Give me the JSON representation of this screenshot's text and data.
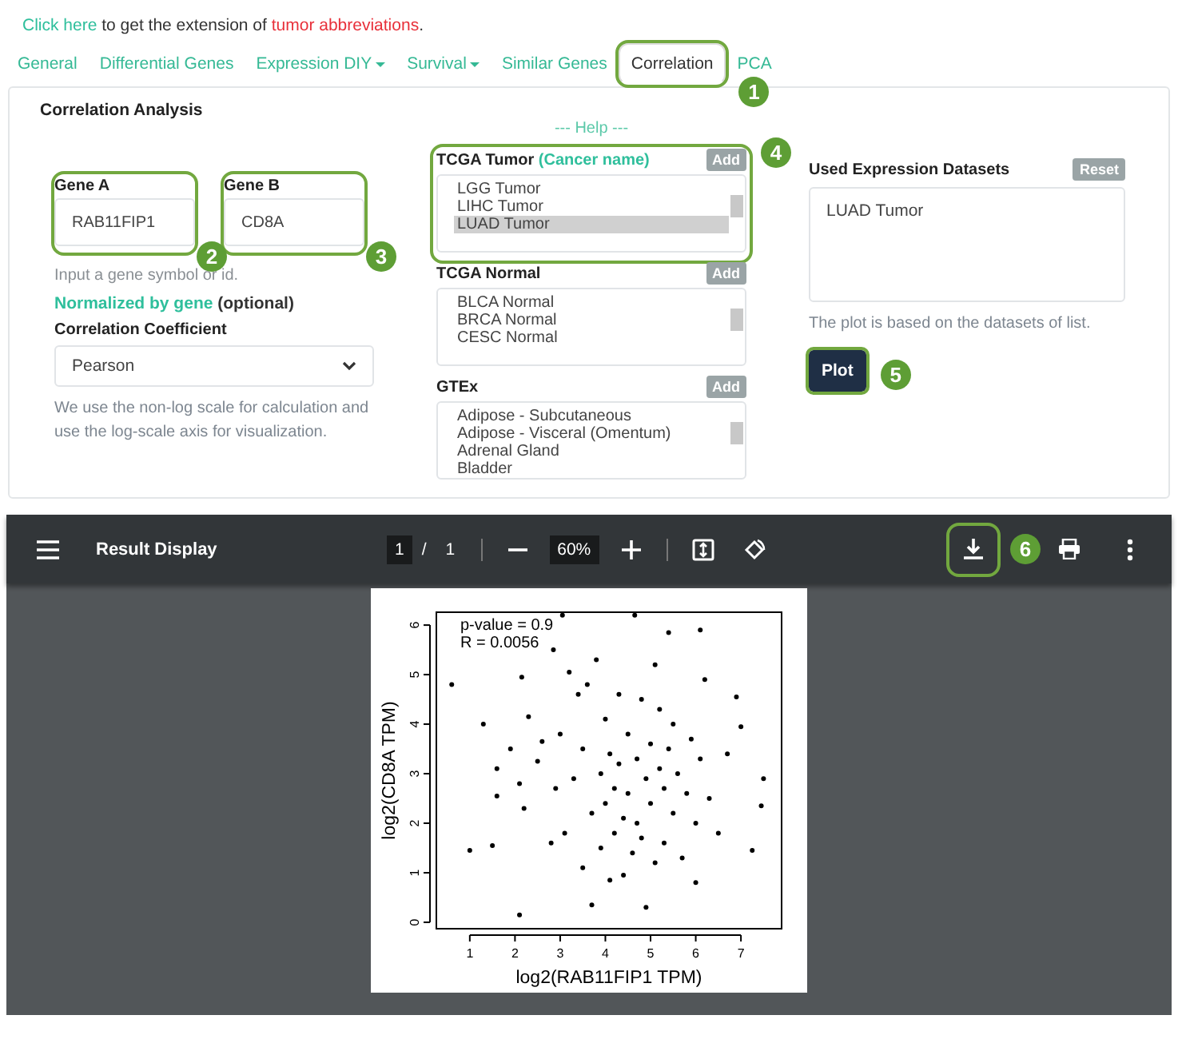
{
  "notice": {
    "link": "Click here",
    "text": " to get the extension of ",
    "highlight": "tumor abbreviations",
    "end": "."
  },
  "tabs": [
    {
      "label": "General",
      "kind": "tab",
      "selected": false,
      "highlighted": false
    },
    {
      "label": "Differential Genes",
      "kind": "tab",
      "selected": false,
      "highlighted": false
    },
    {
      "label": "Expression DIY",
      "kind": "dropdown",
      "selected": false,
      "highlighted": false
    },
    {
      "label": "Survival",
      "kind": "dropdown",
      "selected": false,
      "highlighted": false
    },
    {
      "label": "Similar Genes",
      "kind": "tab",
      "selected": false,
      "highlighted": false
    },
    {
      "label": "Correlation",
      "kind": "tab",
      "selected": true,
      "highlighted": true,
      "callout": "1"
    },
    {
      "label": "PCA",
      "kind": "tab",
      "selected": false,
      "highlighted": false
    }
  ],
  "panel": {
    "title": "Correlation Analysis",
    "help": "--- Help ---",
    "genes": [
      {
        "label": "Gene A",
        "value": "RAB11FIP1",
        "highlighted": true,
        "callout": "2"
      },
      {
        "label": "Gene B",
        "value": "CD8A",
        "highlighted": true,
        "callout": "3"
      }
    ],
    "gene_hint": "Input a gene symbol or id.",
    "normalized": {
      "link": "Normalized by gene",
      "text": "(optional)"
    },
    "coefficient": {
      "label": "Correlation Coefficient",
      "value": "Pearson"
    },
    "scale_note": "We use the non-log scale for calculation and use the log-scale axis for visualization.",
    "dataset_lists": [
      {
        "title": "TCGA Tumor",
        "subtitle": "(Cancer name)",
        "button": "Add",
        "highlighted": true,
        "callout": "4",
        "options": [
          {
            "label": "LGG Tumor",
            "selected": false
          },
          {
            "label": "LIHC Tumor",
            "selected": false
          },
          {
            "label": "LUAD Tumor",
            "selected": true
          }
        ]
      },
      {
        "title": "TCGA Normal",
        "button": "Add",
        "highlighted": false,
        "options": [
          {
            "label": "BLCA Normal",
            "selected": false
          },
          {
            "label": "BRCA Normal",
            "selected": false
          },
          {
            "label": "CESC Normal",
            "selected": false
          }
        ]
      },
      {
        "title": "GTEx",
        "button": "Add",
        "highlighted": false,
        "options": [
          {
            "label": "Adipose - Subcutaneous",
            "selected": false
          },
          {
            "label": "Adipose - Visceral (Omentum)",
            "selected": false
          },
          {
            "label": "Adrenal Gland",
            "selected": false
          },
          {
            "label": "Bladder",
            "selected": false
          }
        ]
      }
    ],
    "used": {
      "title": "Used Expression Datasets",
      "button": "Reset",
      "value": "LUAD Tumor",
      "note": "The plot is based on the datasets of list."
    },
    "plot_button": {
      "label": "Plot",
      "highlighted": true,
      "callout": "5"
    }
  },
  "viewer": {
    "title": "Result Display",
    "page": "1",
    "separator": "/",
    "pages": "1",
    "zoom": "60%",
    "download_highlighted": true,
    "download_callout": "6",
    "chart_data": {
      "type": "scatter",
      "xlabel": "log2(RAB11FIP1 TPM)",
      "ylabel": "log2(CD8A TPM)",
      "xlim": [
        0.26,
        7.9
      ],
      "ylim": [
        -0.13,
        6.26
      ],
      "xticks": [
        1,
        2,
        3,
        4,
        5,
        6,
        7
      ],
      "yticks": [
        0,
        1,
        2,
        3,
        4,
        5,
        6
      ],
      "annotations": [
        {
          "text": "p-value = 0.9"
        },
        {
          "text": "R = 0.0056"
        }
      ],
      "x": [
        0.6,
        1.0,
        1.3,
        1.5,
        1.6,
        1.6,
        1.9,
        2.1,
        2.1,
        2.15,
        2.2,
        2.3,
        2.5,
        2.6,
        2.8,
        2.85,
        2.9,
        3.0,
        3.05,
        3.1,
        3.2,
        3.3,
        3.4,
        3.5,
        3.5,
        3.6,
        3.7,
        3.7,
        3.8,
        3.9,
        3.9,
        4.0,
        4.0,
        4.1,
        4.1,
        4.2,
        4.2,
        4.3,
        4.3,
        4.4,
        4.4,
        4.5,
        4.5,
        4.6,
        4.65,
        4.7,
        4.7,
        4.8,
        4.8,
        4.9,
        4.9,
        5.0,
        5.0,
        5.1,
        5.1,
        5.2,
        5.2,
        5.3,
        5.3,
        5.4,
        5.4,
        5.5,
        5.5,
        5.6,
        5.7,
        5.8,
        5.9,
        6.0,
        6.0,
        6.1,
        6.1,
        6.2,
        6.3,
        6.5,
        6.7,
        6.9,
        7.0,
        7.25,
        7.45,
        7.5
      ],
      "series": [
        {
          "color": "#000000",
          "values": [
            4.8,
            1.45,
            4.0,
            1.55,
            3.1,
            2.55,
            3.5,
            0.15,
            2.8,
            4.95,
            2.3,
            4.15,
            3.25,
            3.65,
            1.6,
            5.5,
            2.7,
            3.8,
            6.2,
            1.8,
            5.05,
            2.9,
            4.6,
            1.1,
            3.5,
            4.8,
            0.35,
            2.2,
            5.3,
            3.0,
            1.5,
            4.1,
            2.4,
            3.4,
            0.85,
            2.7,
            1.8,
            4.6,
            3.2,
            2.1,
            0.95,
            3.8,
            2.6,
            1.4,
            6.2,
            3.3,
            2.0,
            4.5,
            1.7,
            0.3,
            2.9,
            3.6,
            2.4,
            5.2,
            1.2,
            3.1,
            4.3,
            2.7,
            1.6,
            5.85,
            3.5,
            2.2,
            4.0,
            3.0,
            1.3,
            2.6,
            3.7,
            0.8,
            2.0,
            5.9,
            3.3,
            4.9,
            2.5,
            1.8,
            3.4,
            4.55,
            3.95,
            1.45,
            2.35,
            2.9
          ]
        }
      ]
    }
  }
}
